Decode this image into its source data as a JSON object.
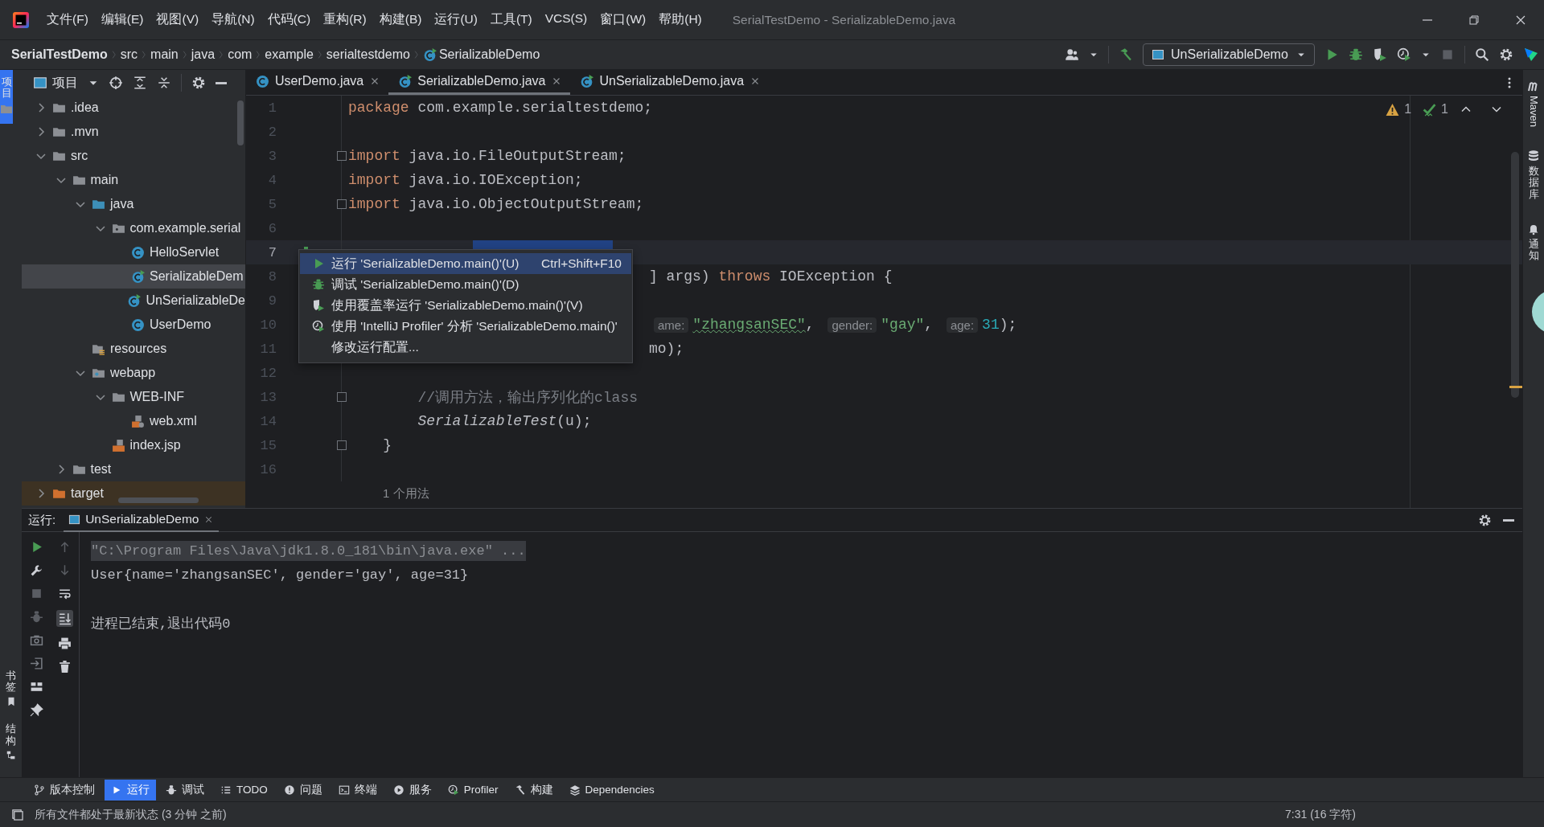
{
  "window": {
    "title": "SerialTestDemo - SerializableDemo.java"
  },
  "menu": [
    {
      "label": "文件(F)"
    },
    {
      "label": "编辑(E)"
    },
    {
      "label": "视图(V)"
    },
    {
      "label": "导航(N)"
    },
    {
      "label": "代码(C)"
    },
    {
      "label": "重构(R)"
    },
    {
      "label": "构建(B)"
    },
    {
      "label": "运行(U)"
    },
    {
      "label": "工具(T)"
    },
    {
      "label": "VCS(S)"
    },
    {
      "label": "窗口(W)"
    },
    {
      "label": "帮助(H)"
    }
  ],
  "breadcrumb": [
    {
      "label": "SerialTestDemo",
      "kind": "project"
    },
    {
      "label": "src",
      "kind": "dir"
    },
    {
      "label": "main",
      "kind": "dir"
    },
    {
      "label": "java",
      "kind": "dir"
    },
    {
      "label": "com",
      "kind": "dir"
    },
    {
      "label": "example",
      "kind": "dir"
    },
    {
      "label": "serialtestdemo",
      "kind": "dir"
    },
    {
      "label": "SerializableDemo",
      "kind": "class"
    }
  ],
  "run_configuration": {
    "label": "UnSerializableDemo"
  },
  "left_stripe": {
    "top": [
      {
        "label": "项目",
        "kind": "folder",
        "selected": true
      }
    ],
    "bottom": [
      {
        "label": "书签",
        "kind": "bookmark",
        "selected": false
      },
      {
        "label": "结构",
        "kind": "structure",
        "selected": false
      }
    ]
  },
  "project_panel": {
    "title": "项目",
    "tree": [
      {
        "label": ".idea",
        "kind": "folder",
        "expanded": false,
        "selected": false
      },
      {
        "label": ".mvn",
        "kind": "folder",
        "expanded": false,
        "selected": false
      },
      {
        "label": "src",
        "kind": "folder",
        "expanded": true,
        "selected": false,
        "children": [
          {
            "label": "main",
            "kind": "folder",
            "expanded": true,
            "selected": false,
            "children": [
              {
                "label": "java",
                "kind": "source",
                "expanded": true,
                "selected": false,
                "children": [
                  {
                    "label": "com.example.serial",
                    "kind": "package",
                    "expanded": true,
                    "selected": false,
                    "children": [
                      {
                        "label": "HelloServlet",
                        "kind": "class",
                        "selected": false
                      },
                      {
                        "label": "SerializableDem",
                        "kind": "runnable",
                        "selected": true
                      },
                      {
                        "label": "UnSerializableDe",
                        "kind": "runnable",
                        "selected": false
                      },
                      {
                        "label": "UserDemo",
                        "kind": "class",
                        "selected": false
                      }
                    ]
                  }
                ]
              },
              {
                "label": "resources",
                "kind": "resources",
                "selected": false
              },
              {
                "label": "webapp",
                "kind": "web",
                "expanded": true,
                "selected": false,
                "children": [
                  {
                    "label": "WEB-INF",
                    "kind": "folder",
                    "expanded": true,
                    "selected": false,
                    "children": [
                      {
                        "label": "web.xml",
                        "kind": "xml",
                        "selected": false
                      }
                    ]
                  },
                  {
                    "label": "index.jsp",
                    "kind": "jsp",
                    "selected": false
                  }
                ]
              }
            ]
          },
          {
            "label": "test",
            "kind": "folder",
            "expanded": false,
            "selected": false
          }
        ]
      },
      {
        "label": "target",
        "kind": "excluded",
        "expanded": false,
        "selected": false
      }
    ]
  },
  "editor_tabs": [
    {
      "label": "UserDemo.java",
      "kind": "class",
      "selected": false
    },
    {
      "label": "SerializableDemo.java",
      "kind": "runnable",
      "selected": true
    },
    {
      "label": "UnSerializableDemo.java",
      "kind": "runnable",
      "selected": false
    }
  ],
  "editor": {
    "inspections": {
      "warnings": "1",
      "checks": "1"
    },
    "lines": [
      {
        "number": "1",
        "segments": [
          {
            "text": "package",
            "kind": "kw"
          },
          {
            "text": " com.example.serialtestdemo;",
            "kind": "plain"
          }
        ]
      },
      {
        "number": "2"
      },
      {
        "number": "3",
        "fold": true,
        "segments": [
          {
            "text": "import",
            "kind": "kw"
          },
          {
            "text": " java.io.FileOutputStream;",
            "kind": "plain"
          }
        ]
      },
      {
        "number": "4",
        "segments": [
          {
            "text": "import",
            "kind": "kw"
          },
          {
            "text": " java.io.IOException;",
            "kind": "plain"
          }
        ]
      },
      {
        "number": "5",
        "fold": true,
        "segments": [
          {
            "text": "import",
            "kind": "kw"
          },
          {
            "text": " java.io.ObjectOutputStream;",
            "kind": "plain"
          }
        ]
      },
      {
        "number": "6"
      },
      {
        "number": "7",
        "current": true,
        "selection": true,
        "run_marker": true,
        "behind_menu": true
      },
      {
        "number": "8",
        "run_marker": true,
        "behind_menu": true,
        "segments": [
          {
            "text": "] args) ",
            "kind": "plain"
          },
          {
            "text": "throws",
            "kind": "kw"
          },
          {
            "text": " IOException {",
            "kind": "plain"
          }
        ]
      },
      {
        "number": "9"
      },
      {
        "number": "10",
        "behind_menu": true,
        "segments": [
          {
            "text": "ame:",
            "kind": "hint"
          },
          {
            "text": "\"zhangsanSEC\"",
            "kind": "str",
            "typo": true
          },
          {
            "text": ", ",
            "kind": "plain"
          },
          {
            "text": "gender:",
            "kind": "hint"
          },
          {
            "text": "\"gay\"",
            "kind": "str"
          },
          {
            "text": ", ",
            "kind": "plain"
          },
          {
            "text": "age:",
            "kind": "hint"
          },
          {
            "text": "31",
            "kind": "num"
          },
          {
            "text": ");",
            "kind": "plain"
          }
        ]
      },
      {
        "number": "11",
        "behind_menu": true,
        "segments": [
          {
            "text": "mo);",
            "kind": "plain"
          }
        ]
      },
      {
        "number": "12"
      },
      {
        "number": "13",
        "fold": true,
        "segments": [
          {
            "text": "        //调用方法，输出序列化的class",
            "kind": "comment"
          }
        ]
      },
      {
        "number": "14",
        "segments": [
          {
            "text": "        SerializableTest",
            "kind": "call"
          },
          {
            "text": "(u);",
            "kind": "plain"
          }
        ]
      },
      {
        "number": "15",
        "fold": true,
        "segments": [
          {
            "text": "    }",
            "kind": "plain"
          }
        ]
      },
      {
        "number": "16"
      }
    ],
    "usage_hint": "1 个用法"
  },
  "context_menu": [
    {
      "label": "运行 'SerializableDemo.main()'(U)",
      "shortcut": "Ctrl+Shift+F10",
      "kind": "run",
      "selected": true
    },
    {
      "label": "调试 'SerializableDemo.main()'(D)",
      "kind": "debug",
      "selected": false
    },
    {
      "label": "使用覆盖率运行 'SerializableDemo.main()'(V)",
      "kind": "coverage",
      "selected": false
    },
    {
      "label": "使用 'IntelliJ Profiler' 分析  'SerializableDemo.main()'",
      "kind": "profiler",
      "selected": false
    },
    {
      "label": "修改运行配置...",
      "selected": false
    }
  ],
  "right_stripe": [
    {
      "label": "Maven",
      "kind": "maven"
    },
    {
      "label": "数据库",
      "kind": "database"
    },
    {
      "label": "通知",
      "kind": "bell"
    }
  ],
  "run_panel": {
    "label": "运行:",
    "tab": "UnSerializableDemo",
    "output": [
      {
        "text": "\"C:\\Program Files\\Java\\jdk1.8.0_181\\bin\\java.exe\" ...",
        "kind": "command"
      },
      {
        "text": "User{name='zhangsanSEC', gender='gay', age=31}",
        "kind": "stdout"
      },
      {
        "text": "进程已结束,退出代码0",
        "kind": "exit"
      }
    ]
  },
  "tool_windows": [
    {
      "label": "版本控制",
      "kind": "branch",
      "selected": false
    },
    {
      "label": "运行",
      "kind": "run",
      "selected": true
    },
    {
      "label": "调试",
      "kind": "debug",
      "selected": false
    },
    {
      "label": "TODO",
      "kind": "list",
      "selected": false
    },
    {
      "label": "问题",
      "kind": "problems",
      "selected": false
    },
    {
      "label": "终端",
      "kind": "terminal",
      "selected": false
    },
    {
      "label": "服务",
      "kind": "services",
      "selected": false
    },
    {
      "label": "Profiler",
      "kind": "profiler",
      "selected": false
    },
    {
      "label": "构建",
      "kind": "build",
      "selected": false
    },
    {
      "label": "Dependencies",
      "kind": "layers",
      "selected": false
    }
  ],
  "status_bar": {
    "message": "所有文件都处于最新状态 (3 分钟 之前)",
    "position": "7:31 (16 字符)"
  }
}
